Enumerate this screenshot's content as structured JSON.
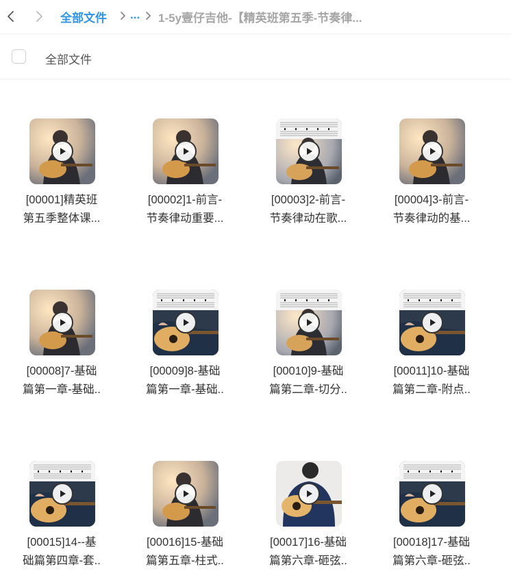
{
  "nav": {
    "root": "全部文件",
    "ellipsis": "...",
    "current": "1-5y壹仔吉他-【精英班第五季-节奏律..."
  },
  "header": {
    "title": "全部文件"
  },
  "files": [
    {
      "line1": "[00001]精英班",
      "line2": "第五季整体课...",
      "thumb": "guitar-player-warm"
    },
    {
      "line1": "[00002]1-前言-",
      "line2": "节奏律动重要...",
      "thumb": "guitar-player-warm"
    },
    {
      "line1": "[00003]2-前言-",
      "line2": "节奏律动在歌...",
      "thumb": "guitar-player-sheet"
    },
    {
      "line1": "[00004]3-前言-",
      "line2": "节奏律动的基...",
      "thumb": "guitar-player-warm"
    },
    {
      "line1": "[00008]7-基础",
      "line2": "篇第一章-基础..",
      "thumb": "guitar-player-warm"
    },
    {
      "line1": "[00009]8-基础",
      "line2": "篇第一章-基础..",
      "thumb": "guitar-closeup-sheet"
    },
    {
      "line1": "[00010]9-基础",
      "line2": "篇第二章-切分..",
      "thumb": "guitar-player-sheet"
    },
    {
      "line1": "[00011]10-基础",
      "line2": "篇第二章-附点..",
      "thumb": "guitar-closeup-sheet"
    },
    {
      "line1": "[00015]14--基",
      "line2": "础篇第四章-套..",
      "thumb": "guitar-closeup-sheet"
    },
    {
      "line1": "[00016]15-基础",
      "line2": "篇第五章-柱式..",
      "thumb": "guitar-player-warm"
    },
    {
      "line1": "[00017]16-基础",
      "line2": "篇第六章-砸弦..",
      "thumb": "guitar-blue-hoodie"
    },
    {
      "line1": "[00018]17-基础",
      "line2": "篇第六章-砸弦..",
      "thumb": "guitar-closeup-sheet"
    }
  ],
  "colors": {
    "accent": "#2e95e8",
    "muted": "#a6a6a6"
  }
}
